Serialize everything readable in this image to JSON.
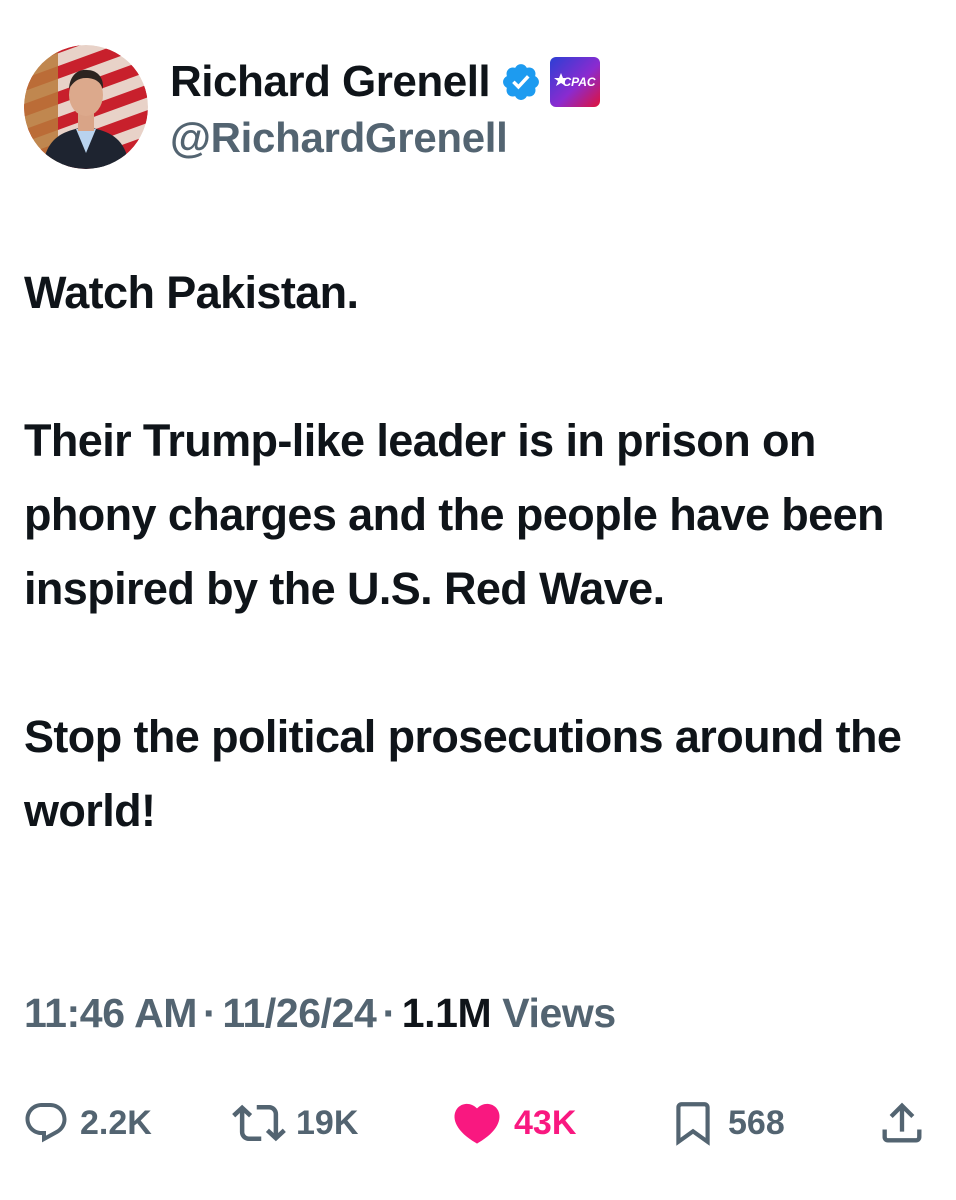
{
  "author": {
    "display_name": "Richard Grenell",
    "handle": "@RichardGrenell",
    "verified_badge_icon": "verified-badge-icon",
    "affiliation_badge_text": "CPAC",
    "verified_color": "#1d9bf0"
  },
  "tweet": {
    "paragraphs": [
      "Watch Pakistan.",
      "Their Trump-like leader is in prison on phony charges and the people have been inspired by the U.S. Red Wave.",
      "Stop the political prosecutions around the world!"
    ]
  },
  "meta": {
    "time": "11:46 AM",
    "separator": "·",
    "date": "11/26/24",
    "views_count": "1.1M",
    "views_label": "Views"
  },
  "actions": {
    "reply": {
      "icon": "reply-icon",
      "count": "2.2K"
    },
    "repost": {
      "icon": "repost-icon",
      "count": "19K"
    },
    "like": {
      "icon": "heart-icon",
      "count": "43K",
      "color": "#f91880",
      "active": true
    },
    "bookmark": {
      "icon": "bookmark-icon",
      "count": "568"
    },
    "share": {
      "icon": "share-icon"
    }
  },
  "colors": {
    "text_primary": "#0f1419",
    "text_secondary": "#536471",
    "like": "#f91880",
    "verified": "#1d9bf0"
  }
}
